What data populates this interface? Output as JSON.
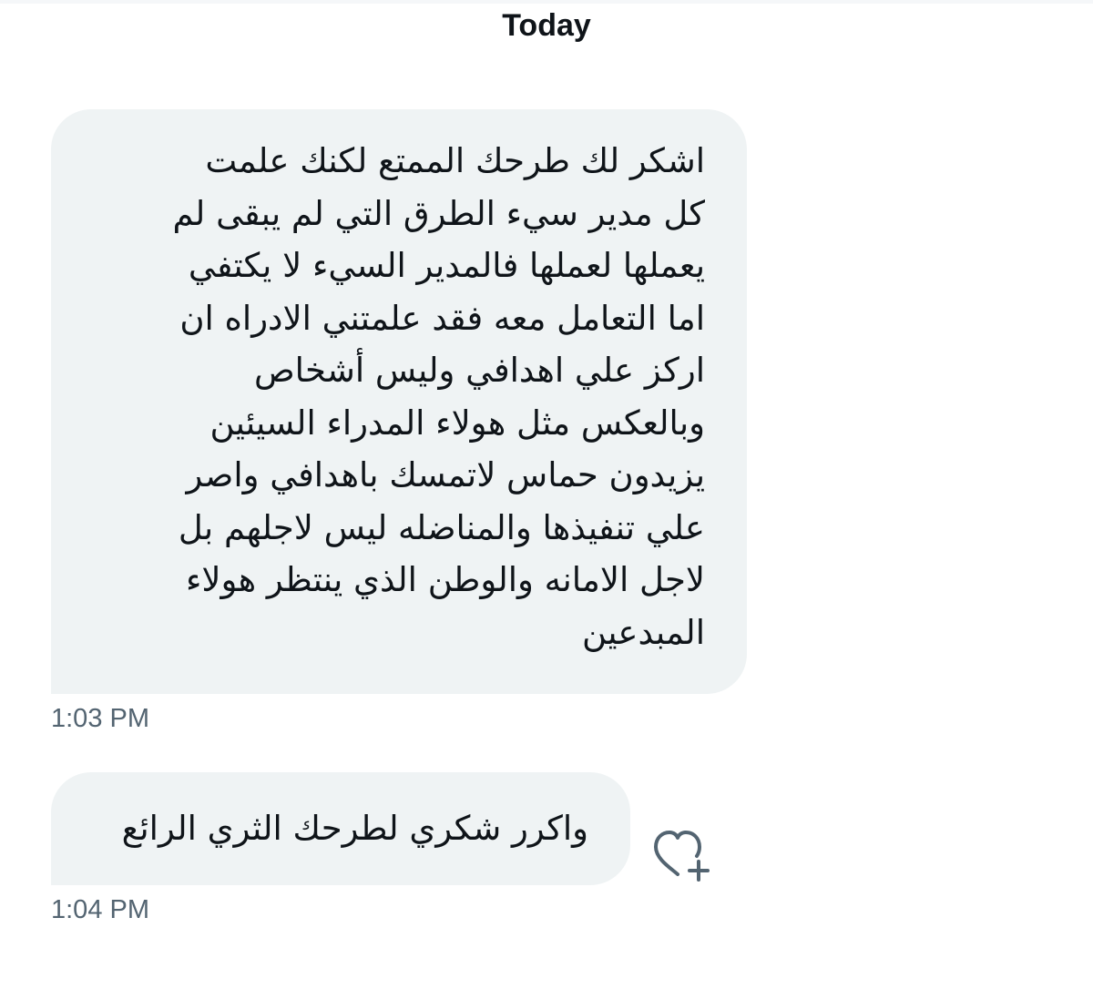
{
  "conversation": {
    "date_separator": "Today",
    "messages": [
      {
        "lines": [
          "اشكر لك طرحك الممتع لكنك علمت",
          "كل مدير سيء الطرق التي لم يبقى لم",
          "يعملها لعملها فالمدير السيء لا يكتفي",
          "اما التعامل معه فقد علمتني الادراه ان",
          "اركز علي اهدافي وليس أشخاص",
          "وبالعكس مثل هولاء المدراء السيئين",
          "يزيدون حماس لاتمسك باهدافي واصر",
          "علي تنفيذها والمناضله ليس لاجلهم بل",
          "لاجل الامانه والوطن الذي ينتظر هولاء",
          "المبدعين"
        ],
        "time": "1:03 PM"
      },
      {
        "text": "واكرر شكري لطرحك الثري الرائع",
        "time": "1:04 PM",
        "reaction_icon": "heart-plus-icon"
      }
    ]
  },
  "colors": {
    "bubble_background": "#eff3f4",
    "message_text": "#0f1419",
    "timestamp_text": "#536471",
    "reaction_icon": "#536471"
  }
}
